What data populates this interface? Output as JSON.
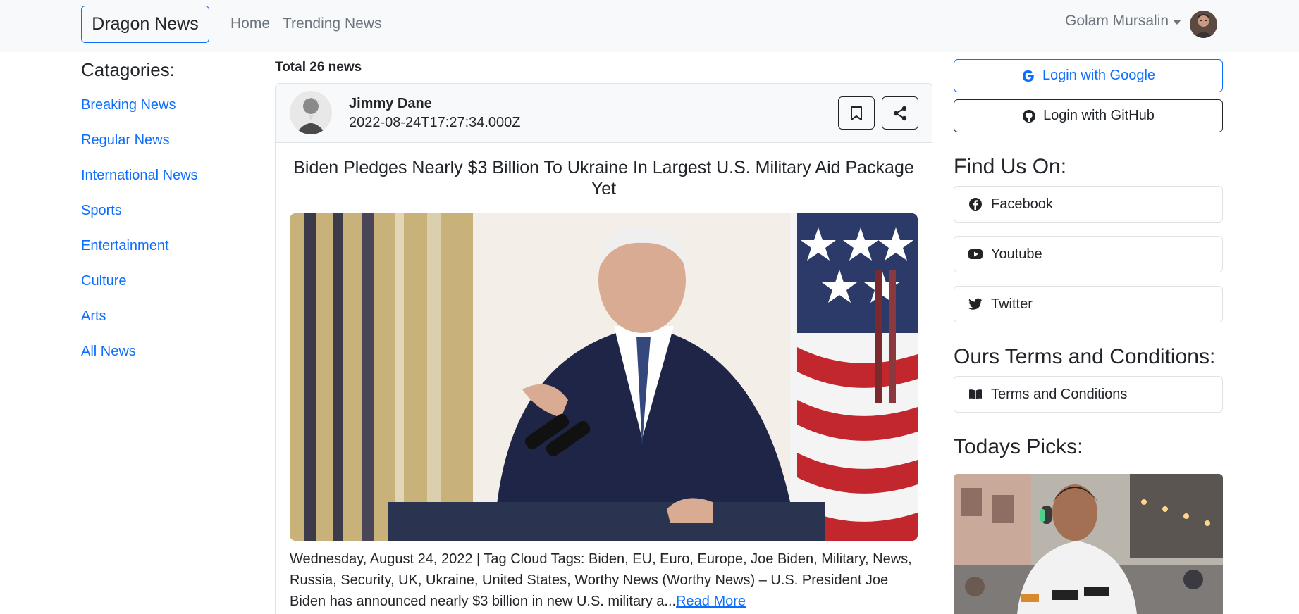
{
  "navbar": {
    "brand": "Dragon News",
    "links": [
      "Home",
      "Trending News"
    ],
    "user_name": "Golam Mursalin"
  },
  "categories": {
    "title": "Catagories:",
    "items": [
      "Breaking News",
      "Regular News",
      "International News",
      "Sports",
      "Entertainment",
      "Culture",
      "Arts",
      "All News"
    ]
  },
  "news": {
    "total_label": "Total 26 news",
    "author_name": "Jimmy Dane",
    "published": "2022-08-24T17:27:34.000Z",
    "title": "Biden Pledges Nearly $3 Billion To Ukraine In Largest U.S. Military Aid Package Yet",
    "excerpt": "Wednesday, August 24, 2022 | Tag Cloud Tags: Biden, EU, Euro, Europe, Joe Biden, Military, News, Russia, Security, UK, Ukraine, United States, Worthy News (Worthy News) – U.S. President Joe Biden has announced nearly $3 billion in new U.S. military a...",
    "read_more": "Read More"
  },
  "sidebar_right": {
    "login_google": "Login with Google",
    "login_github": "Login with GitHub",
    "find_us_title": "Find Us On:",
    "social": [
      "Facebook",
      "Youtube",
      "Twitter"
    ],
    "terms_title": "Ours Terms and Conditions:",
    "terms_link": "Terms and Conditions",
    "picks_title": "Todays Picks:"
  },
  "colors": {
    "primary": "#0d6efd",
    "navbar_bg": "#f8f9fa",
    "text": "#212529",
    "muted": "#6c757d"
  }
}
